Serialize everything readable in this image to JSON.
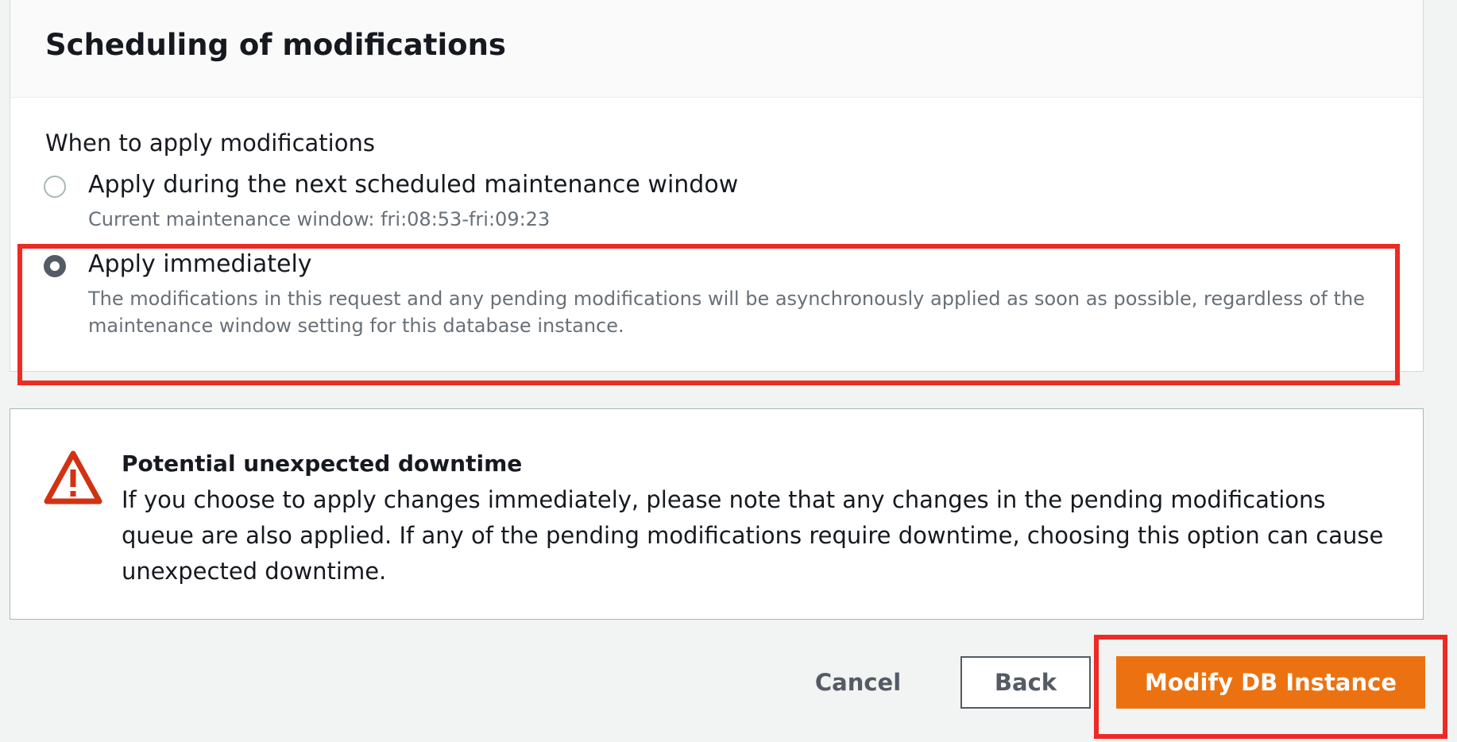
{
  "scheduling_panel": {
    "title": "Scheduling of modifications",
    "field_label": "When to apply modifications",
    "options": [
      {
        "label": "Apply during the next scheduled maintenance window",
        "description": "Current maintenance window: fri:08:53-fri:09:23",
        "selected": false
      },
      {
        "label": "Apply immediately",
        "description": "The modifications in this request and any pending modifications will be asynchronously applied as soon as possible, regardless of the maintenance window setting for this database instance.",
        "selected": true
      }
    ]
  },
  "alert": {
    "icon": "warning-triangle-icon",
    "title": "Potential unexpected downtime",
    "body": "If you choose to apply changes immediately, please note that any changes in the pending modifications queue are also applied. If any of the pending modifications require downtime, choosing this option can cause unexpected downtime."
  },
  "actions": {
    "cancel_label": "Cancel",
    "back_label": "Back",
    "primary_label": "Modify DB Instance"
  },
  "colors": {
    "primary_button": "#ec7211",
    "warning": "#d13212",
    "highlight_annotation": "#ee2a24"
  }
}
